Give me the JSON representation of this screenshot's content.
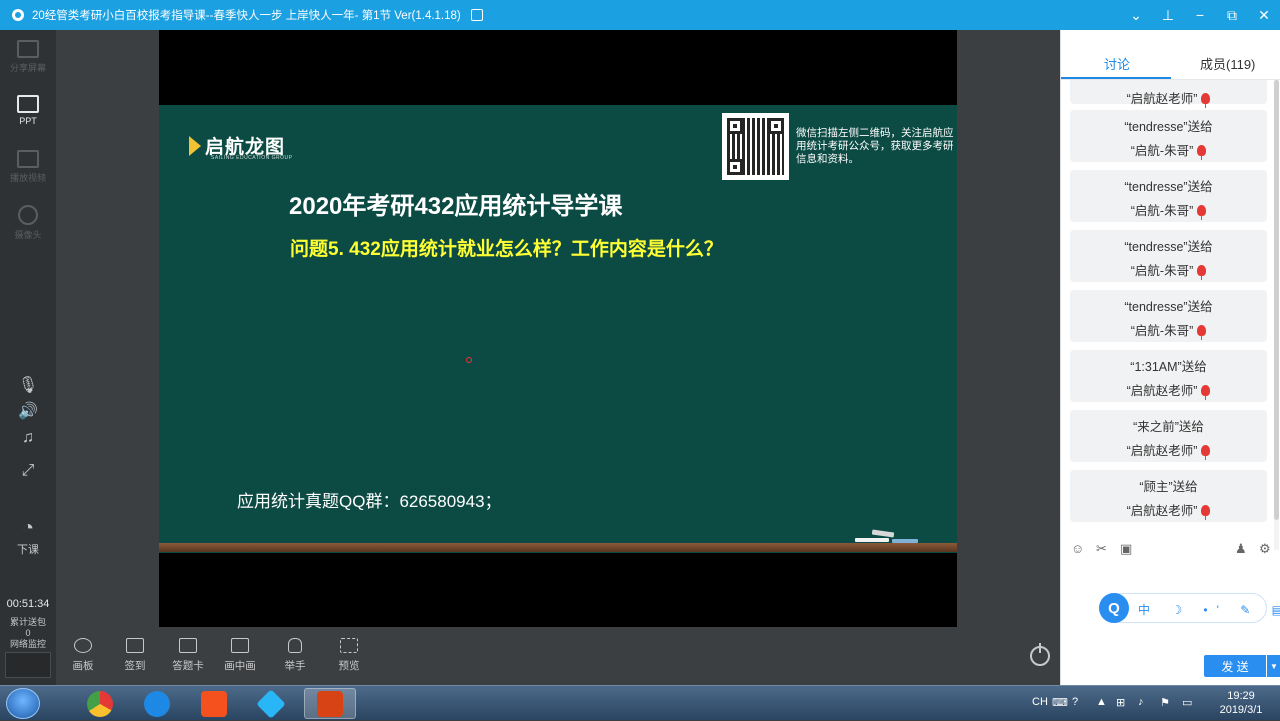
{
  "window": {
    "title": "20经管类考研小白百校报考指导课--春季快人一步 上岸快人一年- 第1节 Ver(1.4.1.18)",
    "controls": [
      "⌄",
      "⊥",
      "−",
      "⧉",
      "✕"
    ]
  },
  "left_sidebar": {
    "items": [
      {
        "label": "分享屏幕",
        "active": false
      },
      {
        "label": "PPT",
        "active": true
      },
      {
        "label": "播放视频",
        "active": false
      },
      {
        "label": "摄像头",
        "active": false
      }
    ],
    "class_end_label": "下课",
    "timer": "00:51:34",
    "gift_label": "累计送包",
    "gift_count": "0",
    "network_label": "网络监控"
  },
  "slide": {
    "logo_name": "启航龙图",
    "logo_sub": "SAILING EDUCATION GROUP",
    "qr_text": "微信扫描左侧二维码，关注启航应用统计考研公众号，获取更多考研信息和资料。",
    "title": "2020年考研432应用统计导学课",
    "question": "问题5. 432应用统计就业怎么样？工作内容是什么？",
    "qq_group": "应用统计真题QQ群：626580943；"
  },
  "bottom_tools": [
    {
      "label": "画板",
      "icon": "palette-icon"
    },
    {
      "label": "签到",
      "icon": "calendar-check-icon"
    },
    {
      "label": "答题卡",
      "icon": "answer-card-icon"
    },
    {
      "label": "画中画",
      "icon": "picture-in-picture-icon"
    },
    {
      "label": "举手",
      "icon": "raise-hand-icon"
    },
    {
      "label": "预览",
      "icon": "preview-icon"
    }
  ],
  "right_panel": {
    "tabs": [
      {
        "label": "讨论",
        "active": true
      },
      {
        "label": "成员(119)",
        "active": false
      }
    ],
    "messages": [
      {
        "sender": "",
        "recipient": "“启航赵老师”"
      },
      {
        "sender": "“tendresse”送给",
        "recipient": "“启航-朱哥”"
      },
      {
        "sender": "“tendresse”送给",
        "recipient": "“启航-朱哥”"
      },
      {
        "sender": "“tendresse”送给",
        "recipient": "“启航-朱哥”"
      },
      {
        "sender": "“tendresse”送给",
        "recipient": "“启航-朱哥”"
      },
      {
        "sender": "“1:31AM”送给",
        "recipient": "“启航赵老师”"
      },
      {
        "sender": "“来之前”送给",
        "recipient": "“启航赵老师”"
      },
      {
        "sender": "“顾主”送给",
        "recipient": "“启航赵老师”"
      }
    ],
    "ime_items": "中 ☽ •' ✎ ▤ ☺",
    "send_label": "发 送"
  },
  "taskbar": {
    "lang": "CH",
    "time": "19:29",
    "date": "2019/3/1"
  },
  "colors": {
    "titlebar": "#1ba1e2",
    "slide_bg": "#0c4a44",
    "question": "#ffff33",
    "accent": "#1e88e5"
  }
}
